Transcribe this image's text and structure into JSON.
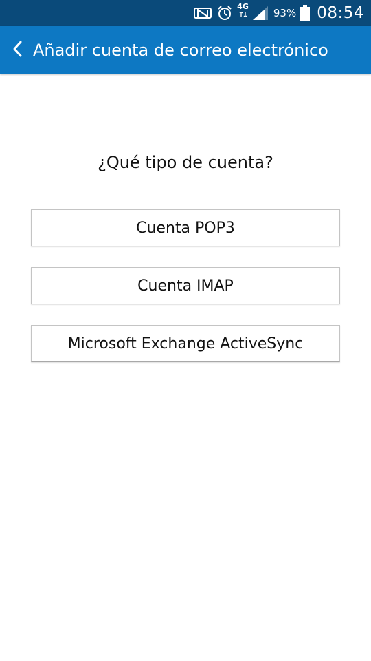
{
  "status_bar": {
    "icons": [
      "nfc-icon",
      "alarm-icon",
      "network-4g-icon",
      "signal-icon",
      "battery-icon"
    ],
    "network": "4G",
    "battery_level": "93%",
    "time": "08:54"
  },
  "header": {
    "back_icon": "chevron-left-icon",
    "title": "Añadir cuenta de correo electrónico"
  },
  "main": {
    "question": "¿Qué tipo de cuenta?",
    "options": [
      {
        "label": "Cuenta POP3"
      },
      {
        "label": "Cuenta IMAP"
      },
      {
        "label": "Microsoft Exchange ActiveSync"
      }
    ]
  },
  "colors": {
    "status_bar_bg": "#0a4a7a",
    "action_bar_bg": "#0d78c3",
    "background": "#ffffff",
    "button_border": "#c4c4c4"
  }
}
